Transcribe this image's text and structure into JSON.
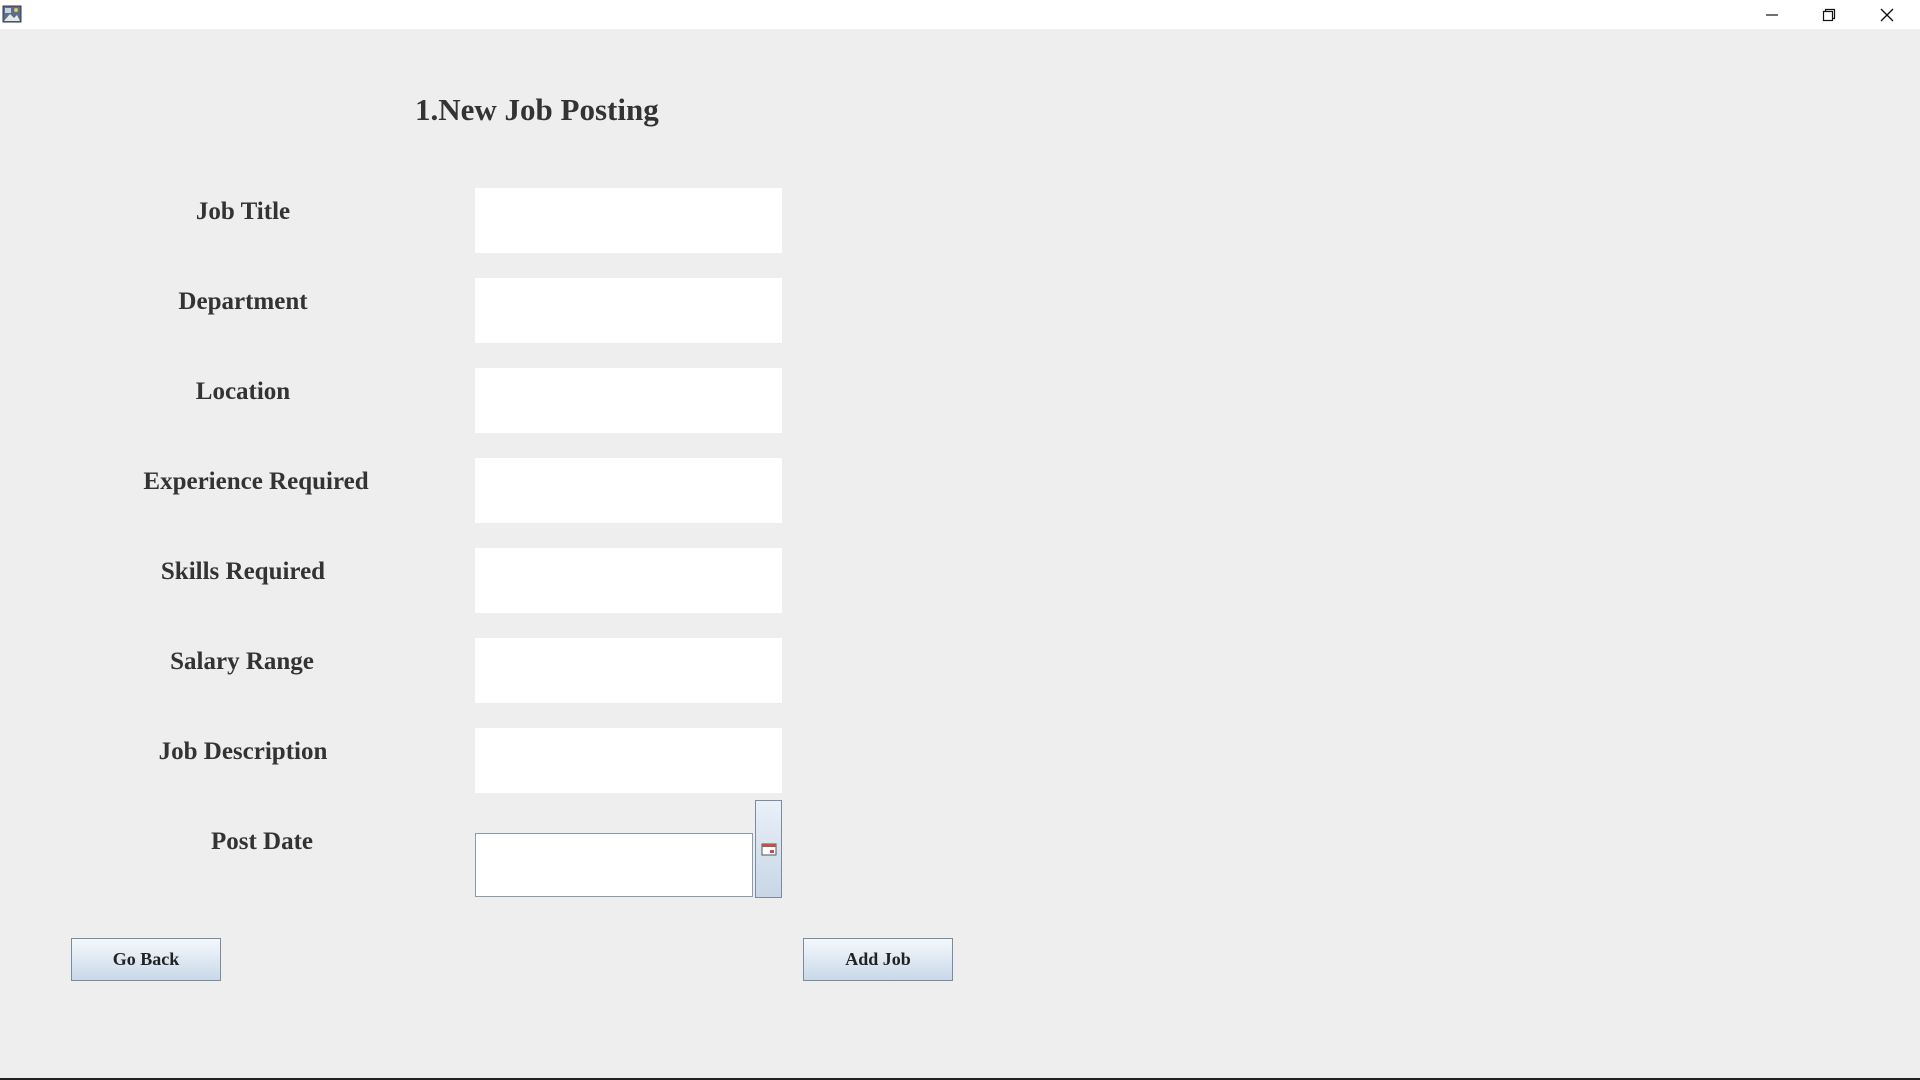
{
  "window": {
    "controls": {
      "minimize_icon": "minimize-icon",
      "maximize_icon": "restore-icon",
      "close_icon": "close-icon"
    }
  },
  "form": {
    "heading": "1.New Job Posting",
    "fields": [
      {
        "label": "Job Title",
        "value": ""
      },
      {
        "label": "Department",
        "value": ""
      },
      {
        "label": "Location",
        "value": ""
      },
      {
        "label": "Experience Required",
        "value": ""
      },
      {
        "label": "Skills Required",
        "value": ""
      },
      {
        "label": "Salary Range",
        "value": ""
      },
      {
        "label": "Job Description",
        "value": ""
      }
    ],
    "post_date": {
      "label": "Post Date",
      "value": "",
      "picker_icon": "calendar-icon"
    }
  },
  "buttons": {
    "go_back": "Go Back",
    "add_job": "Add Job"
  }
}
